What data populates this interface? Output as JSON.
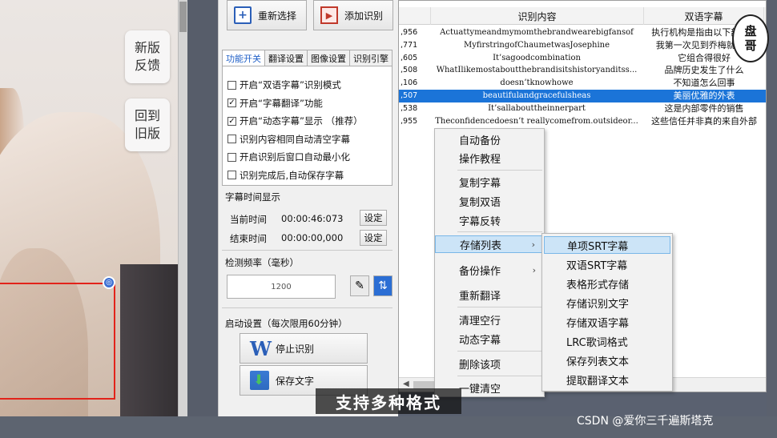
{
  "side_buttons": {
    "feedback": [
      "新版",
      "反馈"
    ],
    "old_version": [
      "回到",
      "旧版"
    ]
  },
  "toolbar": {
    "reselect": "重新选择",
    "add_recognition": "添加识别"
  },
  "tabs": [
    "功能开关",
    "翻译设置",
    "图像设置",
    "识别引擎"
  ],
  "options": [
    {
      "label": "开启“双语字幕”识别模式",
      "checked": false
    },
    {
      "label": "开启“字幕翻译”功能",
      "checked": true
    },
    {
      "label": "开启“动态字幕”显示    （推荐）",
      "checked": true
    },
    {
      "label": "识别内容相同自动清空字幕",
      "checked": false
    },
    {
      "label": "开启识别后窗口自动最小化",
      "checked": false
    },
    {
      "label": "识别完成后,自动保存字幕",
      "checked": false
    }
  ],
  "subtitle_time": {
    "group": "字幕时间显示",
    "current_label": "当前时间",
    "current_value": "00:00:46:073",
    "end_label": "结束时间",
    "end_value": "00:00:00,000",
    "set_label": "设定"
  },
  "detect": {
    "group": "检测频率（毫秒）",
    "value": "1200"
  },
  "startup": {
    "group": "启动设置（每次限用60分钟）",
    "stop": "停止识别",
    "save": "保存文字"
  },
  "table": {
    "headers": [
      "识别内容",
      "双语字幕"
    ],
    "rows": [
      {
        "id": ",956",
        "text": "Actuattymeandmymomthebrandwearebigfansof",
        "trans": "执行机构是指由以下部件..."
      },
      {
        "id": ",771",
        "text": "MyfirstringofChaumetwasJosephine",
        "trans": "我第一次见到乔梅就特..."
      },
      {
        "id": ",605",
        "text": "It’sagoodcombination",
        "trans": "它组合得很好"
      },
      {
        "id": ",508",
        "text": "WhatIlikemostaboutthebrandisitshistoryanditss...",
        "trans": "品牌历史发生了什么"
      },
      {
        "id": ",106",
        "text": "doesn’tknowhowe",
        "trans": "不知道怎么回事"
      },
      {
        "id": ",507",
        "text": "beautifulandgracefulsheas",
        "trans": "美丽优雅的外表",
        "selected": true
      },
      {
        "id": ",538",
        "text": "It’sallabouttheinnerpart",
        "trans": "这是内部零件的销售"
      },
      {
        "id": ",955",
        "text": "Theconfidencedoesn’t reallycomefrom.outsideor...",
        "trans": "这些信任并非真的来自外部"
      }
    ]
  },
  "context_menu": [
    "自动备份",
    "操作教程",
    "复制字幕",
    "复制双语",
    "字幕反转",
    "存储列表",
    "备份操作",
    "重新翻译",
    "清理空行",
    "动态字幕",
    "删除该项",
    "一键清空"
  ],
  "submenu": [
    "单项SRT字幕",
    "双语SRT字幕",
    "表格形式存储",
    "存储识别文字",
    "存储双语字幕",
    "LRC歌词格式",
    "保存列表文本",
    "提取翻译文本"
  ],
  "badge": [
    "盘",
    "哥"
  ],
  "caption": "支持多种格式",
  "footer": "CSDN @爱你三千遍斯塔克"
}
